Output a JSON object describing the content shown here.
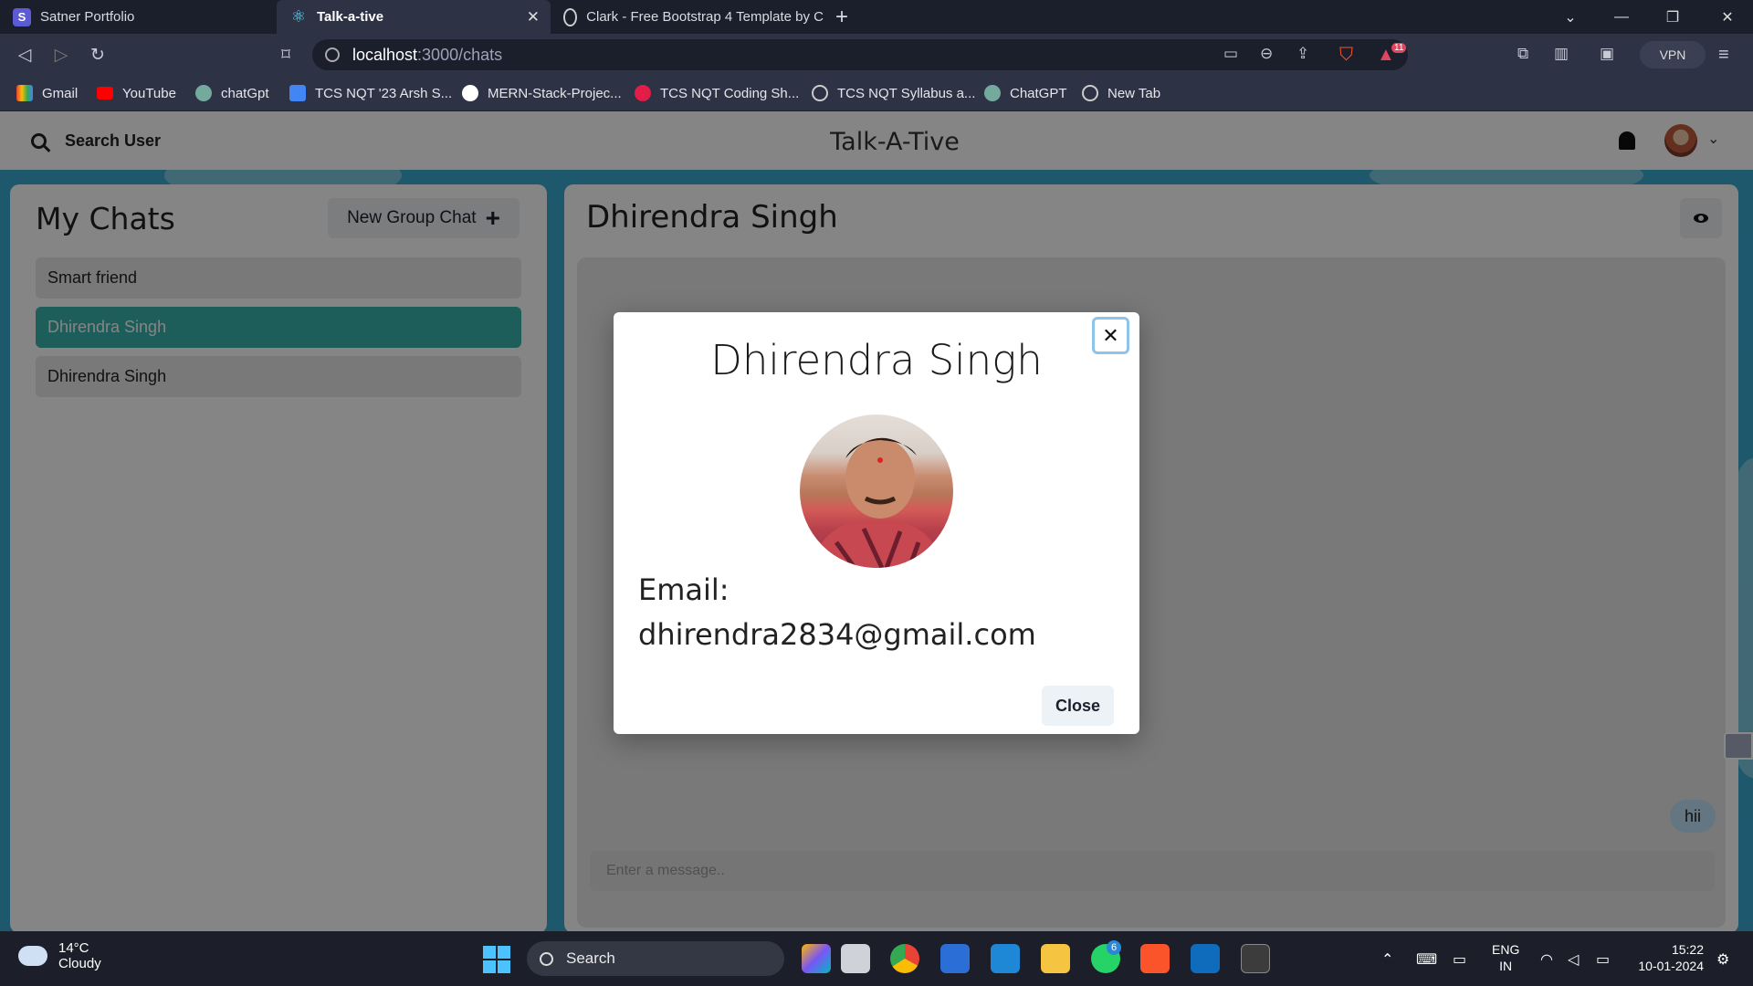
{
  "browser": {
    "tabs": [
      {
        "title": "Satner Portfolio"
      },
      {
        "title": "Talk-a-tive"
      },
      {
        "title": "Clark - Free Bootstrap 4 Template by C"
      }
    ],
    "url_host": "localhost",
    "url_path": ":3000/chats",
    "vpn_label": "VPN",
    "alert_count": "11",
    "bookmarks": [
      {
        "label": "Gmail"
      },
      {
        "label": "YouTube"
      },
      {
        "label": "chatGpt"
      },
      {
        "label": "TCS NQT '23 Arsh S..."
      },
      {
        "label": "MERN-Stack-Projec..."
      },
      {
        "label": "TCS NQT Coding Sh..."
      },
      {
        "label": "TCS NQT Syllabus a..."
      },
      {
        "label": "ChatGPT"
      },
      {
        "label": "New Tab"
      }
    ]
  },
  "app": {
    "search_label": "Search User",
    "title": "Talk-A-Tive",
    "sidebar": {
      "title": "My Chats",
      "new_group_label": "New Group Chat",
      "chats": [
        {
          "name": "Smart friend",
          "selected": false
        },
        {
          "name": "Dhirendra Singh",
          "selected": true
        },
        {
          "name": "Dhirendra Singh",
          "selected": false
        }
      ]
    },
    "chat": {
      "title": "Dhirendra Singh",
      "messages": [
        {
          "text": "hii"
        }
      ],
      "input_placeholder": "Enter a message.."
    },
    "modal": {
      "title": "Dhirendra Singh",
      "email_label": "Email:",
      "email": "dhirendra2834@gmail.com",
      "close_label": "Close"
    }
  },
  "taskbar": {
    "weather_temp": "14°C",
    "weather_desc": "Cloudy",
    "search_label": "Search",
    "whatsapp_badge": "6",
    "lang_top": "ENG",
    "lang_bottom": "IN",
    "time": "15:22",
    "date": "10-01-2024"
  },
  "colors": {
    "accent": "#38b2ac",
    "app_background": "#3aa9d2",
    "bubble": "#bee3f8"
  }
}
